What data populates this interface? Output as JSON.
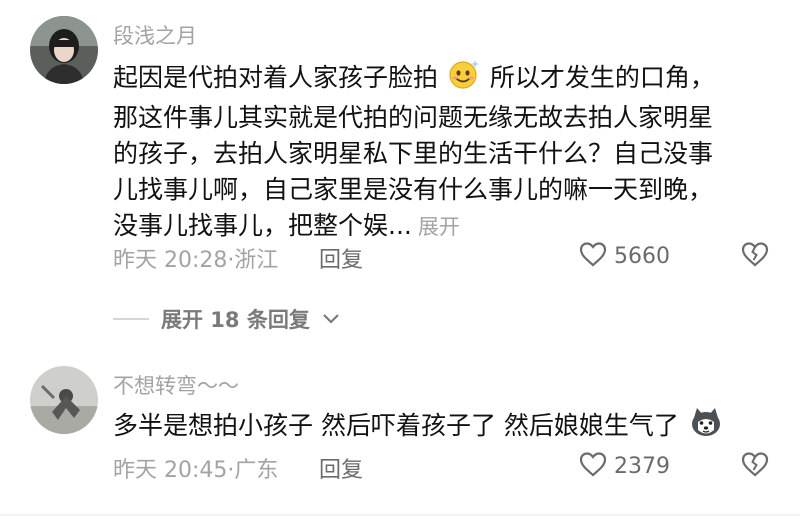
{
  "comments": [
    {
      "username": "段浅之月",
      "lines": [
        "起因是代拍对着人家孩子脸拍",
        "所以才发生的口角，",
        "那这件事儿其实就是代拍的问题无缘无故去拍人家明星",
        "的孩子，去拍人家明星私下里的生活干什么？自己没事",
        "儿找事儿啊，自己家里是没有什么事儿的嘛一天到晚，",
        "没事儿找事儿，把整个娱..."
      ],
      "emoji": "smile-sparkle-emoji",
      "expand_label": "展开",
      "time_location": "昨天 20:28·浙江",
      "reply_label": "回复",
      "likes": "5660"
    },
    {
      "username": "不想转弯～～",
      "lines": [
        "多半是想拍小孩子 然后吓着孩子了 然后娘娘生气了"
      ],
      "emoji": "husky-dog-emoji",
      "time_location": "昨天 20:45·广东",
      "reply_label": "回复",
      "likes": "2379"
    }
  ],
  "more_replies_label": "展开 18 条回复",
  "icons": {
    "like": "heart-outline-icon",
    "dislike": "broken-heart-icon",
    "expand": "chevron-down-icon"
  }
}
